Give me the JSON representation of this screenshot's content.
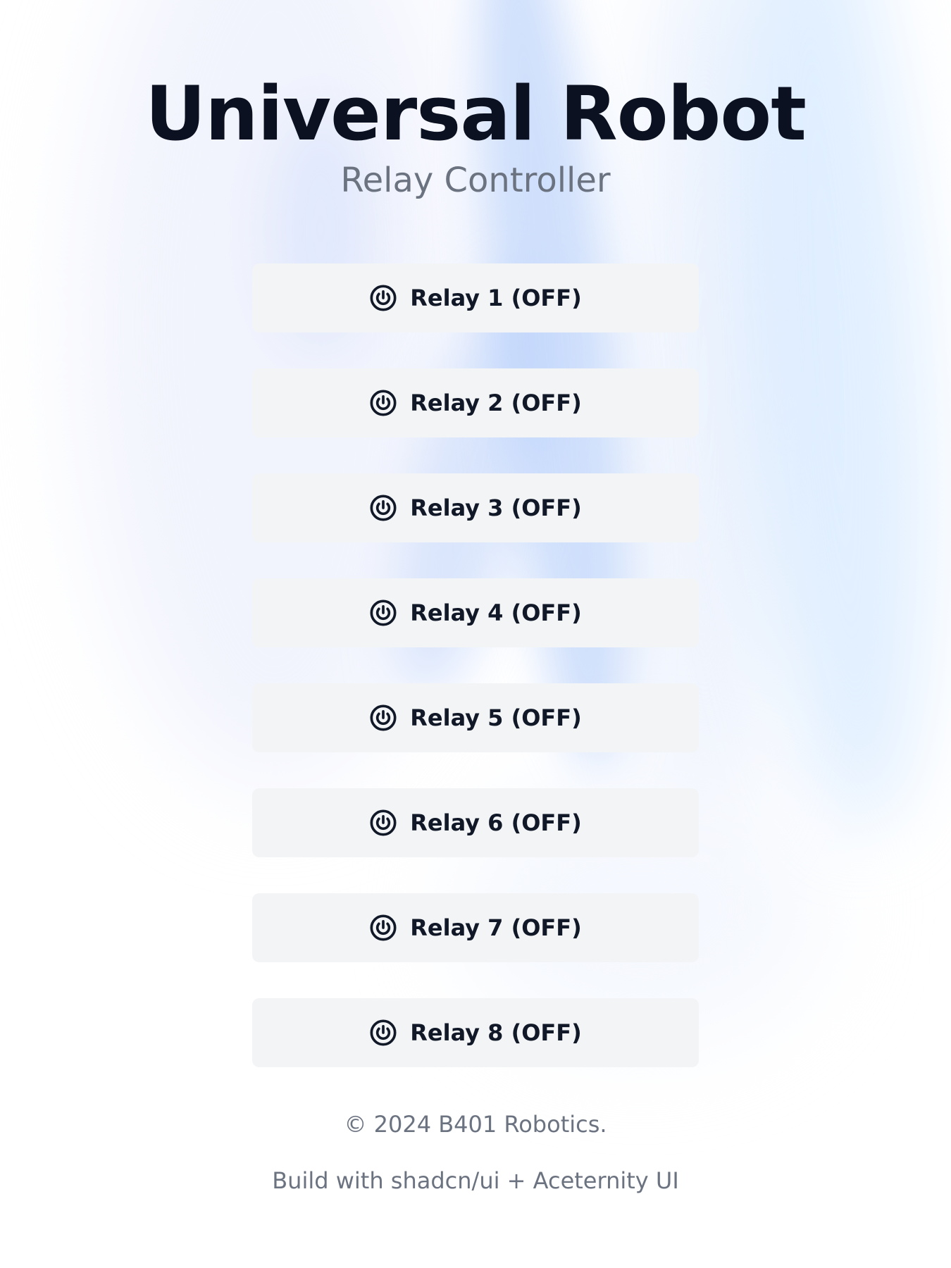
{
  "header": {
    "title": "Universal Robot",
    "subtitle": "Relay Controller"
  },
  "relays": [
    {
      "label": "Relay 1 (OFF)",
      "icon": "power-icon",
      "state": "OFF"
    },
    {
      "label": "Relay 2 (OFF)",
      "icon": "power-icon",
      "state": "OFF"
    },
    {
      "label": "Relay 3 (OFF)",
      "icon": "power-icon",
      "state": "OFF"
    },
    {
      "label": "Relay 4 (OFF)",
      "icon": "power-icon",
      "state": "OFF"
    },
    {
      "label": "Relay 5 (OFF)",
      "icon": "power-icon",
      "state": "OFF"
    },
    {
      "label": "Relay 6 (OFF)",
      "icon": "power-icon",
      "state": "OFF"
    },
    {
      "label": "Relay 7 (OFF)",
      "icon": "power-icon",
      "state": "OFF"
    },
    {
      "label": "Relay 8 (OFF)",
      "icon": "power-icon",
      "state": "OFF"
    }
  ],
  "footer": {
    "copyright": "© 2024 B401 Robotics.",
    "credits": "Build with shadcn/ui + Aceternity UI"
  },
  "colors": {
    "title": "#0b1120",
    "muted_text": "#6b7280",
    "button_bg": "#f3f4f6",
    "button_text": "#111827",
    "accent_glow": "#aac6fa"
  }
}
